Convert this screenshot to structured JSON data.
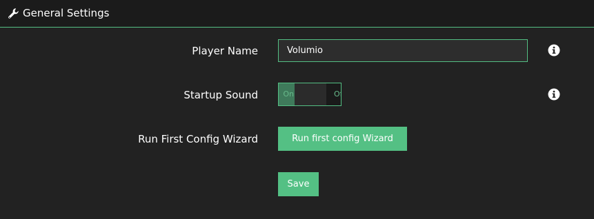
{
  "header": {
    "title": "General Settings",
    "icon": "wrench-icon"
  },
  "player_name": {
    "label": "Player Name",
    "value": "Volumio",
    "info_icon": "info-icon"
  },
  "startup_sound": {
    "label": "Startup Sound",
    "on_text": "On",
    "off_text": "Off",
    "state": "off",
    "info_icon": "info-icon"
  },
  "first_config_wizard": {
    "label": "Run First Config Wizard",
    "button_label": "Run first config Wizard"
  },
  "save": {
    "button_label": "Save"
  },
  "colors": {
    "accent": "#54c084",
    "background": "#222222",
    "header_background": "#1b1b1b"
  }
}
